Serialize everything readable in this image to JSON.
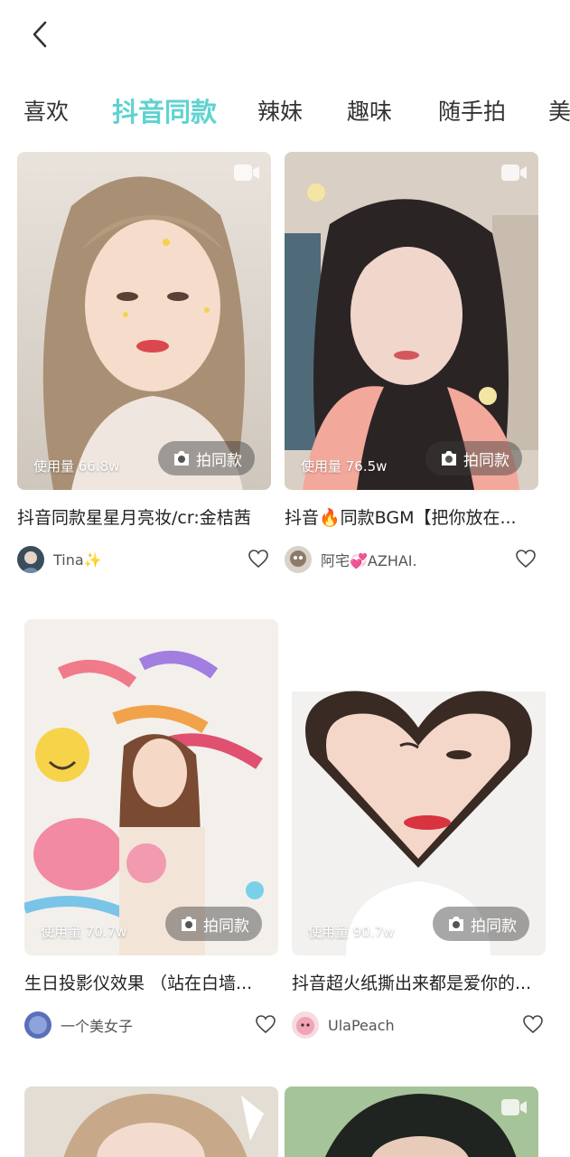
{
  "tabs": [
    "喜欢",
    "抖音同款",
    "辣妹",
    "趣味",
    "随手拍",
    "美"
  ],
  "active_tab": 1,
  "cards": [
    {
      "usage": "使用量 66.8w",
      "button": "拍同款",
      "title": "抖音同款星星月亮妆/cr:金桔茜",
      "user": "Tina✨"
    },
    {
      "usage": "使用量 76.5w",
      "button": "拍同款",
      "title": "抖音🔥同款BGM【把你放在...",
      "user": "阿宅💞AZHAI."
    },
    {
      "usage": "使用量 70.7w",
      "button": "拍同款",
      "title": "生日投影仪效果 （站在白墙...",
      "user": "一个美女子"
    },
    {
      "usage": "使用量 90.7w",
      "button": "拍同款",
      "title": "抖音超火纸撕出来都是爱你的...",
      "user": "UlaPeach"
    }
  ],
  "colors": {
    "accent": "#5fd3d0"
  }
}
